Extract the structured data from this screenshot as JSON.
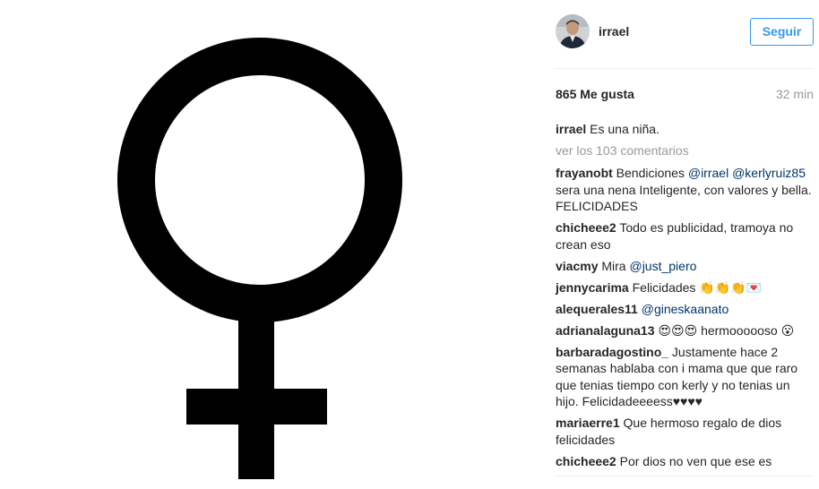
{
  "post": {
    "image_alt": "female symbol"
  },
  "header": {
    "username": "irrael",
    "follow_label": "Seguir"
  },
  "meta": {
    "likes": "865 Me gusta",
    "time": "32 min"
  },
  "caption": {
    "user": "irrael",
    "text": " Es una niña."
  },
  "view_all": "ver los 103 comentarios",
  "comments": [
    {
      "user": "frayanobt",
      "parts": [
        " Bendiciones ",
        {
          "mention": "@irrael"
        },
        " ",
        {
          "mention": "@kerlyruiz85"
        },
        " sera una nena Inteligente, con valores y bella. FELICIDADES"
      ]
    },
    {
      "user": "chicheee2",
      "parts": [
        " Todo es publicidad, tramoya no crean eso"
      ]
    },
    {
      "user": "viacmy",
      "parts": [
        " Mira ",
        {
          "mention": "@just_piero"
        }
      ]
    },
    {
      "user": "jennycarima",
      "parts": [
        " Felicidades 👏👏👏💌"
      ]
    },
    {
      "user": "alequerales11",
      "parts": [
        " ",
        {
          "mention": "@gineskaanato"
        }
      ]
    },
    {
      "user": "adrianalaguna13",
      "parts": [
        " 😍😍😍 hermoooooso 😮"
      ]
    },
    {
      "user": "barbaradagostino_",
      "parts": [
        " Justamente hace 2 semanas hablaba con i mama que que raro que tenias tiempo con kerly y no tenias un hijo. Felicidadeeeess♥♥♥♥"
      ]
    },
    {
      "user": "mariaerre1",
      "parts": [
        " Que hermoso regalo de dios felicidades"
      ]
    },
    {
      "user": "chicheee2",
      "parts": [
        " Por dios no ven que ese es"
      ]
    }
  ],
  "colors": {
    "accent": "#3897f0",
    "mention": "#003569",
    "muted": "#999999",
    "text": "#262626"
  }
}
